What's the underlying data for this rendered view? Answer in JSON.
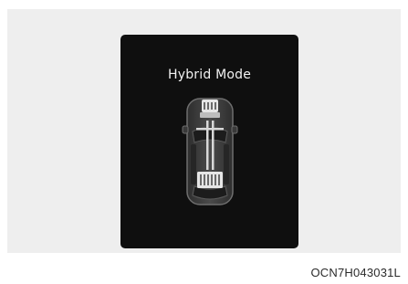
{
  "display": {
    "title": "Hybrid Mode"
  },
  "figure": {
    "code": "OCN7H043031L"
  },
  "icons": {
    "car": "car-top-view-icon",
    "engine": "engine-icon",
    "battery": "battery-icon"
  },
  "colors": {
    "screen_background": "#0f0f0f",
    "text": "#f2f2f2",
    "frame_background": "#eeeeee"
  }
}
